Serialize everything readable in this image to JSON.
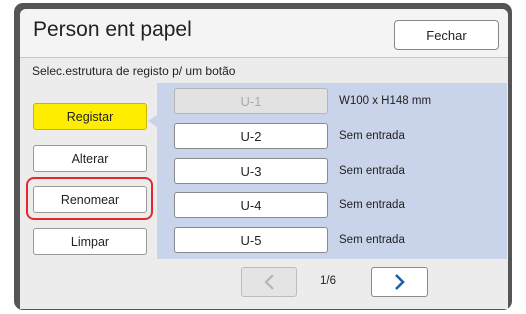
{
  "header": {
    "title": "Person ent papel",
    "close_label": "Fechar"
  },
  "instruction": "Selec.estrutura de registo p/ um botão",
  "actions": {
    "register": "Registar",
    "change": "Alterar",
    "rename": "Renomear",
    "clear": "Limpar"
  },
  "slots": [
    {
      "name": "U-1",
      "info": "W100 x H148 mm",
      "enabled": false
    },
    {
      "name": "U-2",
      "info": "Sem entrada",
      "enabled": true
    },
    {
      "name": "U-3",
      "info": "Sem entrada",
      "enabled": true
    },
    {
      "name": "U-4",
      "info": "Sem entrada",
      "enabled": true
    },
    {
      "name": "U-5",
      "info": "Sem entrada",
      "enabled": true
    }
  ],
  "pagination": {
    "page": "1/6"
  },
  "icons": {
    "prev": "chevron-left-icon",
    "next": "chevron-right-icon"
  },
  "colors": {
    "active_button": "#ffed00",
    "highlight": "#e4282e",
    "panel": "#c9d3ea",
    "next_arrow": "#1f5fa8"
  }
}
